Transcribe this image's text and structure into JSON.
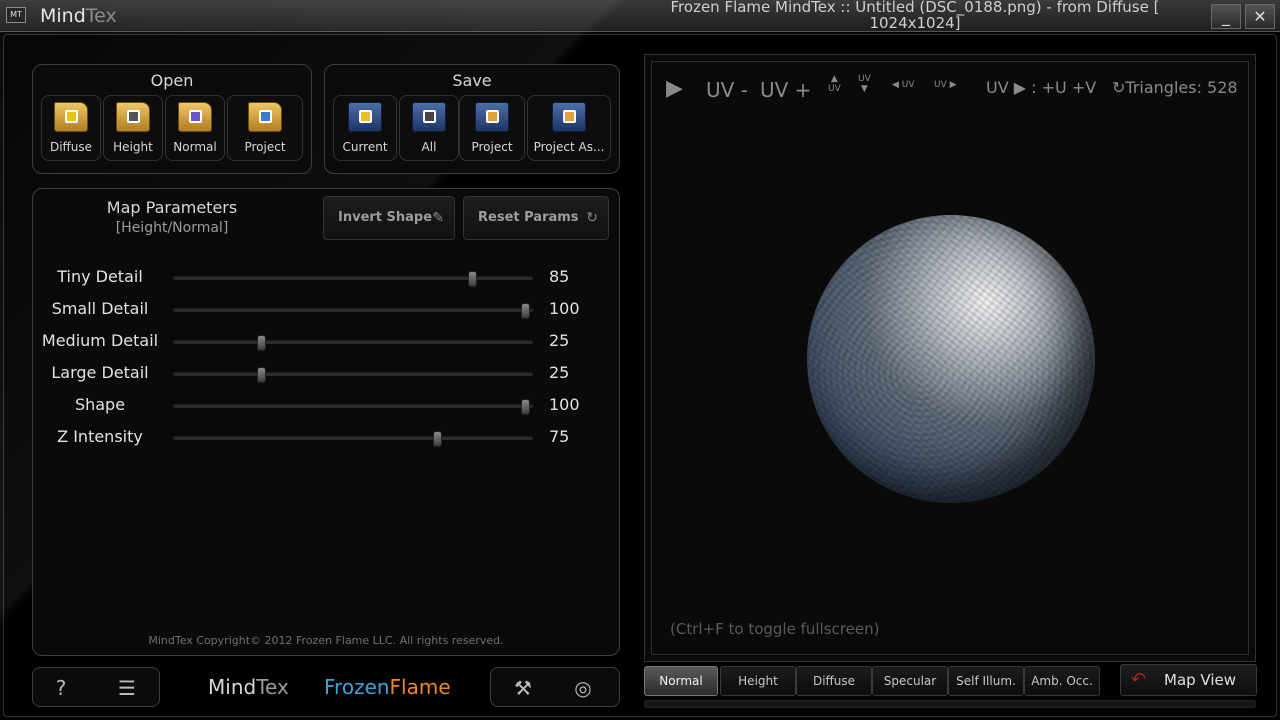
{
  "app": {
    "badge": "MT",
    "name_part1": "Mind",
    "name_part2": "Tex",
    "window_title": "Frozen Flame MindTex :: Untitled (DSC_0188.png) - from Diffuse [ 1024x1024]",
    "minimize_glyph": "_",
    "close_glyph": "✕"
  },
  "open_group": {
    "title": "Open",
    "items": [
      {
        "label": "Diffuse",
        "icon": "folder-diffuse-icon"
      },
      {
        "label": "Height",
        "icon": "folder-height-icon"
      },
      {
        "label": "Normal",
        "icon": "folder-normal-icon"
      },
      {
        "label": "Project",
        "icon": "folder-project-icon"
      }
    ]
  },
  "save_group": {
    "title": "Save",
    "items": [
      {
        "label": "Current",
        "icon": "disk-current-icon"
      },
      {
        "label": "All",
        "icon": "disk-all-icon"
      },
      {
        "label": "Project",
        "icon": "disk-project-icon"
      },
      {
        "label": "Project As...",
        "icon": "disk-project-as-icon"
      }
    ]
  },
  "params": {
    "title": "Map Parameters",
    "subtitle": "[Height/Normal]",
    "invert_label": "Invert Shape",
    "reset_label": "Reset Params",
    "sliders": [
      {
        "label": "Tiny Detail",
        "value": 85,
        "display": "85"
      },
      {
        "label": "Small Detail",
        "value": 100,
        "display": "100"
      },
      {
        "label": "Medium Detail",
        "value": 25,
        "display": "25"
      },
      {
        "label": "Large Detail",
        "value": 25,
        "display": "25"
      },
      {
        "label": "Shape",
        "value": 100,
        "display": "100"
      },
      {
        "label": "Z Intensity",
        "value": 75,
        "display": "75"
      }
    ],
    "copyright": "MindTex Copyright© 2012 Frozen Flame LLC. All rights reserved."
  },
  "footer": {
    "help_glyph": "?",
    "book_glyph": "☰",
    "wrench_glyph": "⚒",
    "globe_glyph": "◎",
    "logo_mindtex_1": "Mind",
    "logo_mindtex_2": "Tex",
    "logo_ff_1": "Frozen",
    "logo_ff_2": "Flame"
  },
  "viewport": {
    "play_glyph": "▶",
    "uv_minus": "UV -",
    "uv_plus": "UV +",
    "uv_small": "UV",
    "uv_run": "UV ▶ : +U +V",
    "triangles": "Triangles: 528",
    "fullscreen_hint": "(Ctrl+F to toggle fullscreen)"
  },
  "tabs": [
    {
      "label": "Normal",
      "active": true
    },
    {
      "label": "Height",
      "active": false
    },
    {
      "label": "Diffuse",
      "active": false
    },
    {
      "label": "Specular",
      "active": false
    },
    {
      "label": "Self Illum.",
      "active": false
    },
    {
      "label": "Amb. Occ.",
      "active": false
    }
  ],
  "map_view_label": "Map View",
  "colors": {
    "accent_blue": "#39a6d6",
    "accent_orange": "#e98a1d",
    "active_tab": "#5a5a5a"
  }
}
